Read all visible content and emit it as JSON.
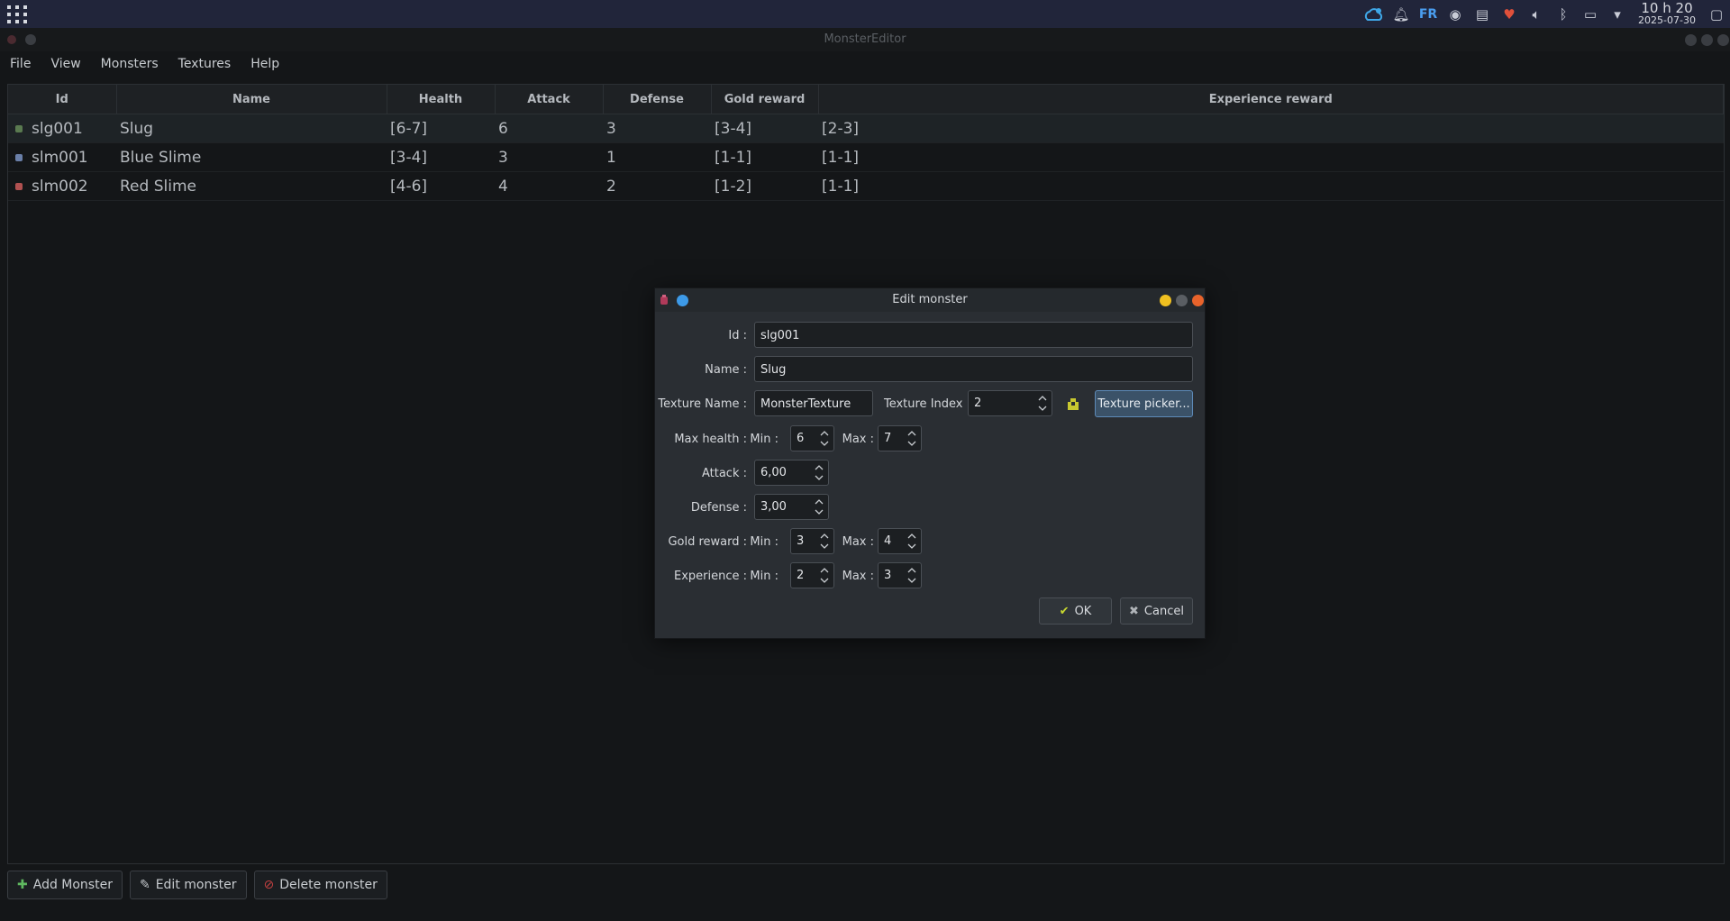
{
  "panel": {
    "lang": "FR",
    "clock_time": "10 h 20",
    "clock_date": "2025-07-30"
  },
  "window": {
    "title": "MonsterEditor"
  },
  "menu": [
    "File",
    "View",
    "Monsters",
    "Textures",
    "Help"
  ],
  "table": {
    "columns": [
      "Id",
      "Name",
      "Health",
      "Attack",
      "Defense",
      "Gold reward",
      "Experience reward"
    ],
    "rows": [
      {
        "id": "slg001",
        "name": "Slug",
        "health": "[6-7]",
        "attack": "6",
        "defense": "3",
        "gold": "[3-4]",
        "exp": "[2-3]",
        "icon_color": "#5a7a50"
      },
      {
        "id": "slm001",
        "name": "Blue Slime",
        "health": "[3-4]",
        "attack": "3",
        "defense": "1",
        "gold": "[1-1]",
        "exp": "[1-1]",
        "icon_color": "#6a7fa8"
      },
      {
        "id": "slm002",
        "name": "Red Slime",
        "health": "[4-6]",
        "attack": "4",
        "defense": "2",
        "gold": "[1-2]",
        "exp": "[1-1]",
        "icon_color": "#b05050"
      }
    ]
  },
  "bottom": {
    "add": "Add Monster",
    "edit": "Edit monster",
    "delete": "Delete monster"
  },
  "dialog": {
    "title": "Edit monster",
    "id_label": "Id :",
    "id_value": "slg001",
    "name_label": "Name :",
    "name_value": "Slug",
    "texture_name_label": "Texture Name :",
    "texture_name_value": "MonsterTexture",
    "texture_index_label": "Texture Index :",
    "texture_index_value": "2",
    "texture_picker": "Texture picker...",
    "max_health_label": "Max health :",
    "min_label": "Min :",
    "max_label": "Max :",
    "health_min": "6",
    "health_max": "7",
    "attack_label": "Attack :",
    "attack_value": "6,00",
    "defense_label": "Defense :",
    "defense_value": "3,00",
    "gold_label": "Gold reward :",
    "gold_min": "3",
    "gold_max": "4",
    "exp_label": "Experience :",
    "exp_min": "2",
    "exp_max": "3",
    "ok": "OK",
    "cancel": "Cancel"
  },
  "colors": {
    "accent": "#3d9ae8",
    "close": "#e8632b",
    "minimize": "#f0c020"
  }
}
